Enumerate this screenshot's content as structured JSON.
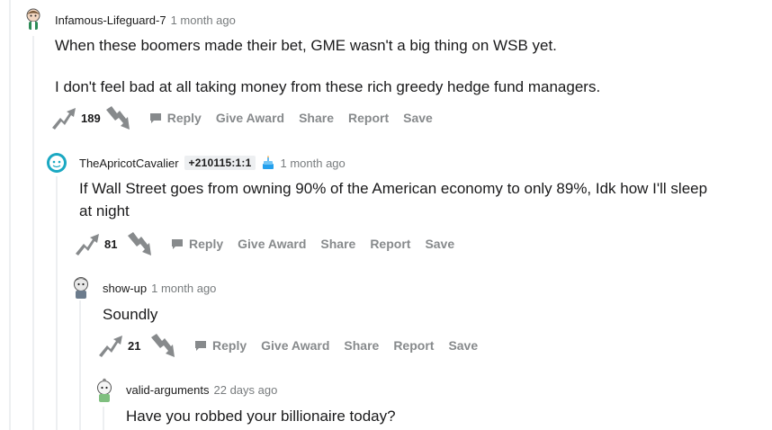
{
  "comments": [
    {
      "user": "Infamous-Lifeguard-7",
      "time": "1 month ago",
      "paragraphs": [
        "When these boomers made their bet, GME wasn't a big thing on WSB yet.",
        "I don't feel bad at all taking money from these rich greedy hedge fund managers."
      ],
      "score": "189",
      "avatar_icon": "snoo-avatar-icon"
    },
    {
      "user": "TheApricotCavalier",
      "flair": "+210115:1:1",
      "cake_icon": "cake-day-icon",
      "time": "1 month ago",
      "paragraphs": [
        "If Wall Street goes from owning 90% of the American economy to only 89%, Idk how I'll sleep",
        "at night"
      ],
      "score": "81",
      "avatar_icon": "snoo-avatar-icon"
    },
    {
      "user": "show-up",
      "time": "1 month ago",
      "paragraphs": [
        "Soundly"
      ],
      "score": "21",
      "avatar_icon": "snoo-avatar-icon"
    },
    {
      "user": "valid-arguments",
      "time": "22 days ago",
      "paragraphs": [
        "Have you robbed your billionaire today?"
      ],
      "avatar_icon": "snoo-avatar-icon"
    }
  ],
  "actions": {
    "reply": "Reply",
    "give_award": "Give Award",
    "share": "Share",
    "report": "Report",
    "save": "Save"
  },
  "colors": {
    "action_text": "#878a8c",
    "meta_time": "#787c7e",
    "thread_line": "#edeff1",
    "vote_arrow": "#878a8c"
  }
}
